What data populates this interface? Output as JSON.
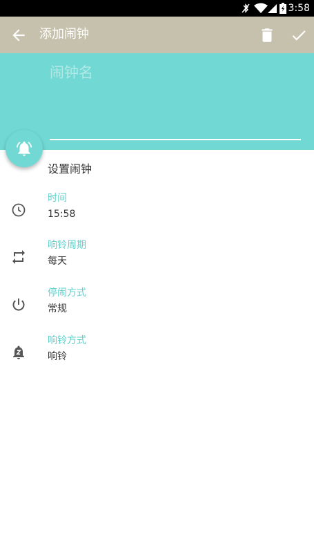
{
  "status_bar": {
    "time": "3:58",
    "icons": [
      "bluetooth-off-icon",
      "wifi-icon",
      "signal-icon",
      "battery-icon"
    ]
  },
  "toolbar": {
    "title": "添加闹钟",
    "back_icon": "arrow-left-icon",
    "delete_icon": "trash-icon",
    "confirm_icon": "check-icon",
    "background": "#c6c1ad"
  },
  "header": {
    "background": "#71d8d4",
    "name_placeholder": "闹钟名",
    "name_value": "",
    "fab_icon": "alarm-ring-icon"
  },
  "settings": {
    "section_title": "设置闹钟",
    "items": [
      {
        "icon": "clock-icon",
        "label": "时间",
        "value": "15:58"
      },
      {
        "icon": "repeat-icon",
        "label": "响铃周期",
        "value": "每天"
      },
      {
        "icon": "power-icon",
        "label": "停闹方式",
        "value": "常规"
      },
      {
        "icon": "alarm-snooze-icon",
        "label": "响铃方式",
        "value": "响铃"
      }
    ]
  },
  "colors": {
    "accent": "#71d8d4",
    "label": "#5fcfcb",
    "text": "#333333"
  }
}
